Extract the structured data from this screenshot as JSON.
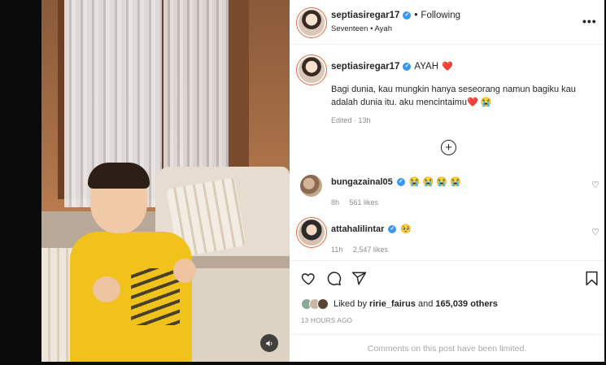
{
  "header": {
    "username": "septiasiregar17",
    "verified_icon": "verified-badge-icon",
    "separator": "•",
    "follow_status": "Following",
    "audio": "Seventeen • Ayah",
    "more_icon": "more-options-icon",
    "more_label": "•••"
  },
  "caption": {
    "username": "septiasiregar17",
    "title": "AYAH",
    "title_emoji": "❤️",
    "body": "Bagi dunia, kau mungkin hanya seseorang namun bagiku kau adalah dunia itu. aku mencintaimu❤️ 😭",
    "edited": "Edited · 13h",
    "load_more_icon": "plus-circle-icon",
    "load_more_label": "+"
  },
  "comments": [
    {
      "username": "bungazainal05",
      "text": "😭 😭 😭 😭",
      "time": "8h",
      "likes": "561 likes",
      "heart_icon": "heart-outline-icon",
      "heart_label": "♡"
    },
    {
      "username": "attahalilintar",
      "text": "🥺",
      "time": "11h",
      "likes": "2,547 likes",
      "heart_icon": "heart-outline-icon",
      "heart_label": "♡"
    }
  ],
  "actions": {
    "like_icon": "heart-outline-icon",
    "comment_icon": "comment-bubble-icon",
    "share_icon": "paper-plane-icon",
    "save_icon": "bookmark-icon"
  },
  "likes": {
    "prefix": "Liked by",
    "user": "ririe_fairus",
    "middle": "and",
    "count": "165,039 others"
  },
  "timestamp": "13 HOURS AGO",
  "comments_limited": "Comments on this post have been limited.",
  "media": {
    "mute_icon": "speaker-icon"
  },
  "colors": {
    "accent": "#3897f0",
    "heart": "#ed1c24",
    "muted_text": "#8e8e8e"
  }
}
